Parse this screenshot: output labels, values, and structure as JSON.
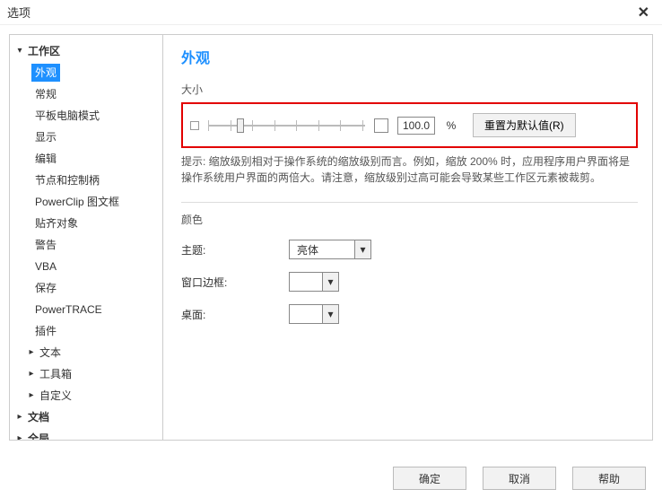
{
  "window": {
    "title": "选项"
  },
  "tree": {
    "root": [
      {
        "label": "工作区",
        "expanded": true
      },
      {
        "label": "文档",
        "expanded": false
      },
      {
        "label": "全局",
        "expanded": false
      }
    ],
    "workspace_children": {
      "appearance": "外观",
      "general": "常规",
      "tablet": "平板电脑模式",
      "display": "显示",
      "edit": "编辑",
      "nodes": "节点和控制柄",
      "powerclip": "PowerClip 图文框",
      "snap": "贴齐对象",
      "warn": "警告",
      "vba": "VBA",
      "save": "保存",
      "powertrace": "PowerTRACE",
      "plugins": "插件",
      "text": "文本",
      "toolbox": "工具箱",
      "custom": "自定义"
    }
  },
  "panel": {
    "heading": "外观",
    "size_label": "大小",
    "size_value": "100.0",
    "size_suffix": "%",
    "reset_button": "重置为默认值(R)",
    "hint": "提示: 缩放级别相对于操作系统的缩放级别而言。例如，缩放 200% 时，应用程序用户界面将是操作系统用户界面的两倍大。请注意，缩放级别过高可能会导致某些工作区元素被裁剪。",
    "color_label": "颜色",
    "theme_label": "主题:",
    "theme_value": "亮体",
    "border_label": "窗口边框:",
    "desktop_label": "桌面:"
  },
  "footer": {
    "ok": "确定",
    "cancel": "取消",
    "help": "帮助"
  }
}
